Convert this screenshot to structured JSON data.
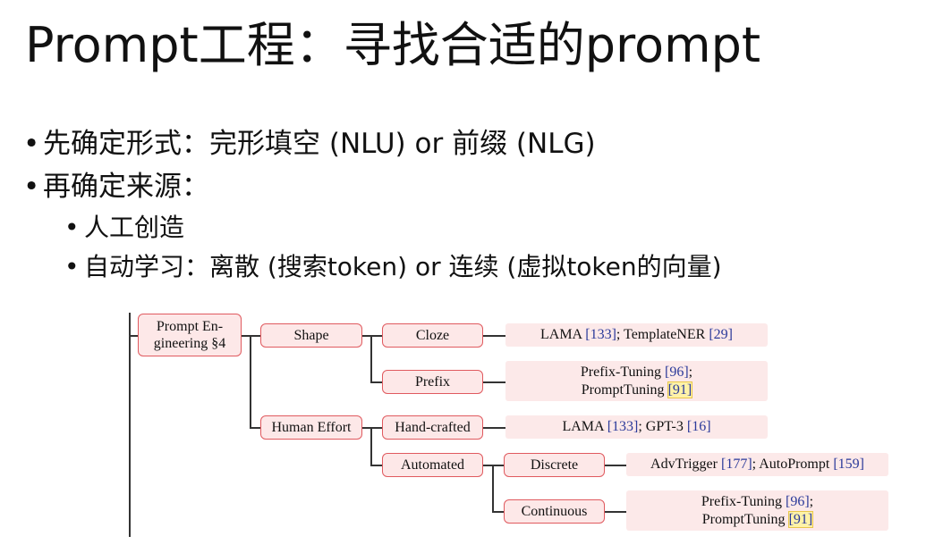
{
  "slide": {
    "title": "Prompt工程：寻找合适的prompt",
    "bullets": [
      "先确定形式：完形填空 (NLU) or 前缀 (NLG)",
      "再确定来源："
    ],
    "sub_bullets": [
      "人工创造",
      "自动学习：离散 (搜索token) or 连续 (虚拟token的向量)"
    ],
    "bullet_glyph": "•"
  },
  "diagram": {
    "root": [
      "Prompt En-",
      "gineering §4"
    ],
    "shape": "Shape",
    "cloze": "Cloze",
    "prefix": "Prefix",
    "human_effort": "Human Effort",
    "hand_crafted": "Hand-crafted",
    "automated": "Automated",
    "discrete": "Discrete",
    "continuous": "Continuous",
    "leaves": {
      "cloze": {
        "a": "LAMA ",
        "a_ref": "[133]",
        "b": "; TemplateNER ",
        "b_ref": "[29]"
      },
      "prefix": {
        "l1": "Prefix-Tuning ",
        "l1_ref": "[96]",
        "l1_end": ";",
        "l2": "PromptTuning ",
        "l2_ref": "[91]"
      },
      "hand_crafted": {
        "a": "LAMA ",
        "a_ref": "[133]",
        "b": "; GPT-3 ",
        "b_ref": "[16]"
      },
      "discrete": {
        "a": "AdvTrigger ",
        "a_ref": "[177]",
        "b": "; AutoPrompt ",
        "b_ref": "[159]"
      },
      "continuous": {
        "l1": "Prefix-Tuning ",
        "l1_ref": "[96]",
        "l1_end": ";",
        "l2": "PromptTuning ",
        "l2_ref": "[91]"
      }
    }
  }
}
